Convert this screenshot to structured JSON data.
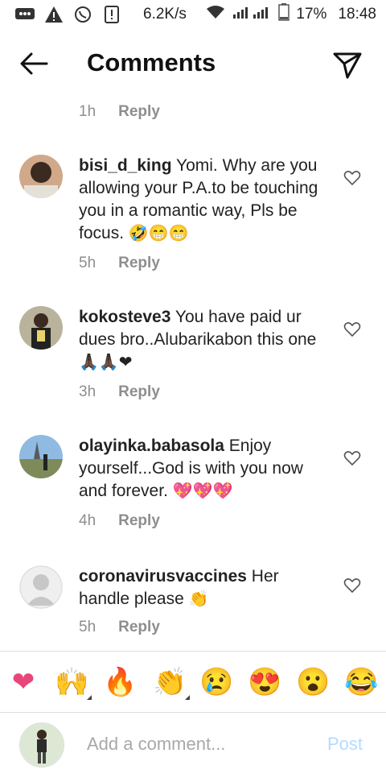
{
  "status_bar": {
    "speed": "6.2K/s",
    "battery": "17%",
    "time": "18:48"
  },
  "header": {
    "title": "Comments"
  },
  "top_meta": {
    "time": "1h",
    "reply": "Reply"
  },
  "comments": [
    {
      "username": "bisi_d_king",
      "text": "Yomi.  Why are you allowing your P.A.to be touching you in a romantic way, Pls be focus.",
      "emojis": "🤣😁😁",
      "time": "5h",
      "reply": "Reply"
    },
    {
      "username": "kokosteve3",
      "text": "You have paid ur dues bro..Alubarikabon this one",
      "emojis": "🙏🏿🙏🏿❤",
      "time": "3h",
      "reply": "Reply"
    },
    {
      "username": "olayinka.babasola",
      "text": "Enjoy yourself...God is with you now and forever.",
      "emojis": "💖💖💖",
      "time": "4h",
      "reply": "Reply"
    },
    {
      "username": "coronavirusvaccines",
      "text": "Her handle please",
      "emojis": "👏",
      "time": "5h",
      "reply": "Reply"
    }
  ],
  "reactions": [
    "❤",
    "🙌",
    "🔥",
    "👏",
    "😢",
    "😍",
    "😮",
    "😂"
  ],
  "composer": {
    "placeholder": "Add a comment...",
    "post_label": "Post"
  },
  "colors": {
    "heart_red": "#e8457a",
    "post_blue": "#b3dbff",
    "meta_gray": "#8e8e8e"
  }
}
